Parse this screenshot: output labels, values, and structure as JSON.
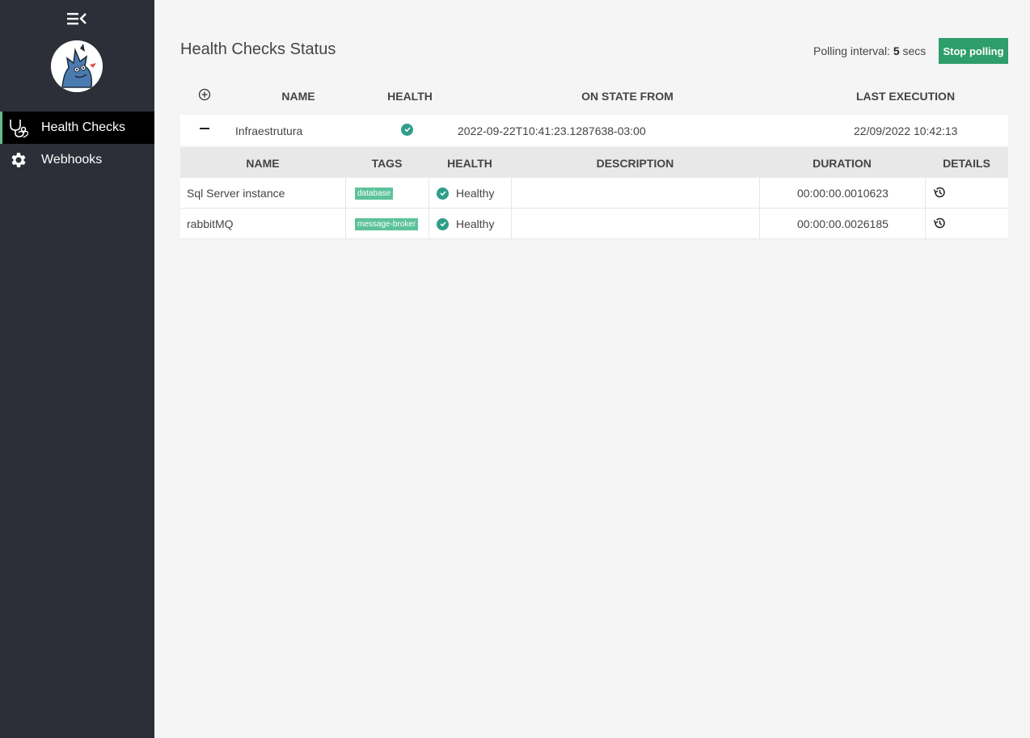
{
  "sidebar": {
    "items": [
      {
        "label": "Health Checks",
        "icon": "stethoscope-icon",
        "active": true
      },
      {
        "label": "Webhooks",
        "icon": "gear-icon",
        "active": false
      }
    ]
  },
  "header": {
    "title": "Health Checks Status",
    "polling_label": "Polling interval:",
    "polling_value": "5",
    "polling_unit": "secs",
    "stop_button": "Stop polling"
  },
  "outer_table": {
    "columns": [
      "NAME",
      "HEALTH",
      "ON STATE FROM",
      "LAST EXECUTION"
    ],
    "rows": [
      {
        "name": "Infraestrutura",
        "health": "healthy",
        "on_state_from": "2022-09-22T10:41:23.1287638-03:00",
        "last_execution": "22/09/2022 10:42:13"
      }
    ]
  },
  "inner_table": {
    "columns": [
      "NAME",
      "TAGS",
      "HEALTH",
      "DESCRIPTION",
      "DURATION",
      "DETAILS"
    ],
    "rows": [
      {
        "name": "Sql Server instance",
        "tag": "database",
        "health": "Healthy",
        "description": "",
        "duration": "00:00:00.0010623"
      },
      {
        "name": "rabbitMQ",
        "tag": "message-broker",
        "health": "Healthy",
        "description": "",
        "duration": "00:00:00.0026185"
      }
    ]
  },
  "colors": {
    "sidebar_bg": "#2c2f38",
    "accent": "#2e9e6a",
    "tag_bg": "#5cc29b",
    "healthy": "#2e9e8a"
  }
}
